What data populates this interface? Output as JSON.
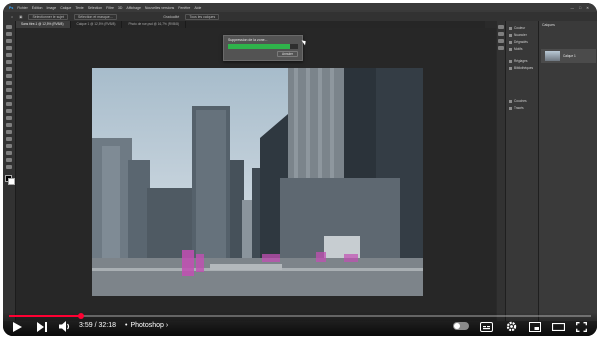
{
  "photoshop": {
    "menu": [
      "Fichier",
      "Édition",
      "Image",
      "Calque",
      "Texte",
      "Sélection",
      "Filtre",
      "3D",
      "Affichage",
      "Nouvelles versions",
      "Fenêtre",
      "Aide"
    ],
    "options": {
      "select_subject": "Sélectionner le sujet",
      "select_mask": "Sélection et masque…",
      "mode_label": "Gradualité",
      "mode_value": "Tous les calques"
    },
    "tabs": [
      {
        "label": "Sans titre-1 @ 12,5% (RVB/8)",
        "active": true
      },
      {
        "label": "Calque 1 @ 12,5% (RVB/8)",
        "active": false
      },
      {
        "label": "Photo de rue.psd @ 16,7% (RVB/8)",
        "active": false
      }
    ],
    "progress_dialog": {
      "title": "Suppression de la zone...",
      "percent": 88,
      "cancel_label": "Annuler"
    },
    "right_panels": [
      "Couleur",
      "Nuancier",
      "Dégradés",
      "Motifs",
      "Réglages",
      "Bibliothèques",
      "Couches",
      "Tracés"
    ],
    "layers_panel": {
      "title": "Calques",
      "layer_name": "Calque 1"
    }
  },
  "player": {
    "elapsed": "3:59",
    "duration": "32:18",
    "time_separator": " / ",
    "chapter": "Photoshop",
    "chapter_arrow": "›",
    "progress_fraction": 0.124,
    "progress_color": "#ff0033"
  }
}
